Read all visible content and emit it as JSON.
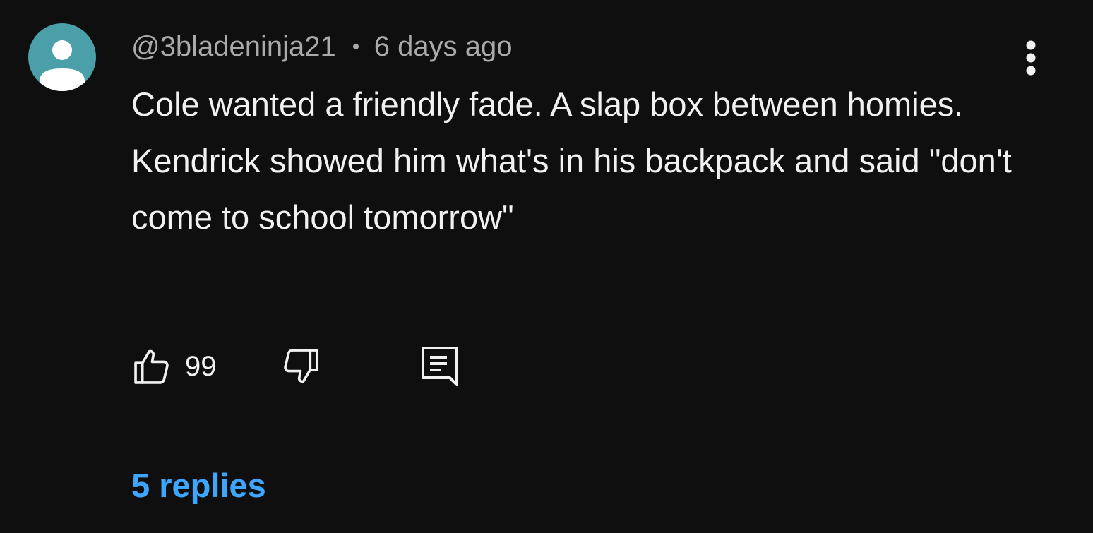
{
  "comment": {
    "author": "@3bladeninja21",
    "timestamp": "6 days ago",
    "text": "Cole wanted a friendly fade. A slap box between homies. Kendrick showed him what's in his backpack and said \"don't come to school tomorrow\"",
    "like_count": "99",
    "replies_label": "5 replies"
  },
  "icons": {
    "avatar": "default-avatar-icon",
    "more": "more-vert-icon",
    "like": "thumb-up-icon",
    "dislike": "thumb-down-icon",
    "reply": "comment-reply-icon"
  },
  "colors": {
    "background": "#0f0f0f",
    "text": "#f1f1f1",
    "meta": "#aaaaaa",
    "avatar_bg": "#4a9fa8",
    "replies_link": "#3ea6ff"
  }
}
